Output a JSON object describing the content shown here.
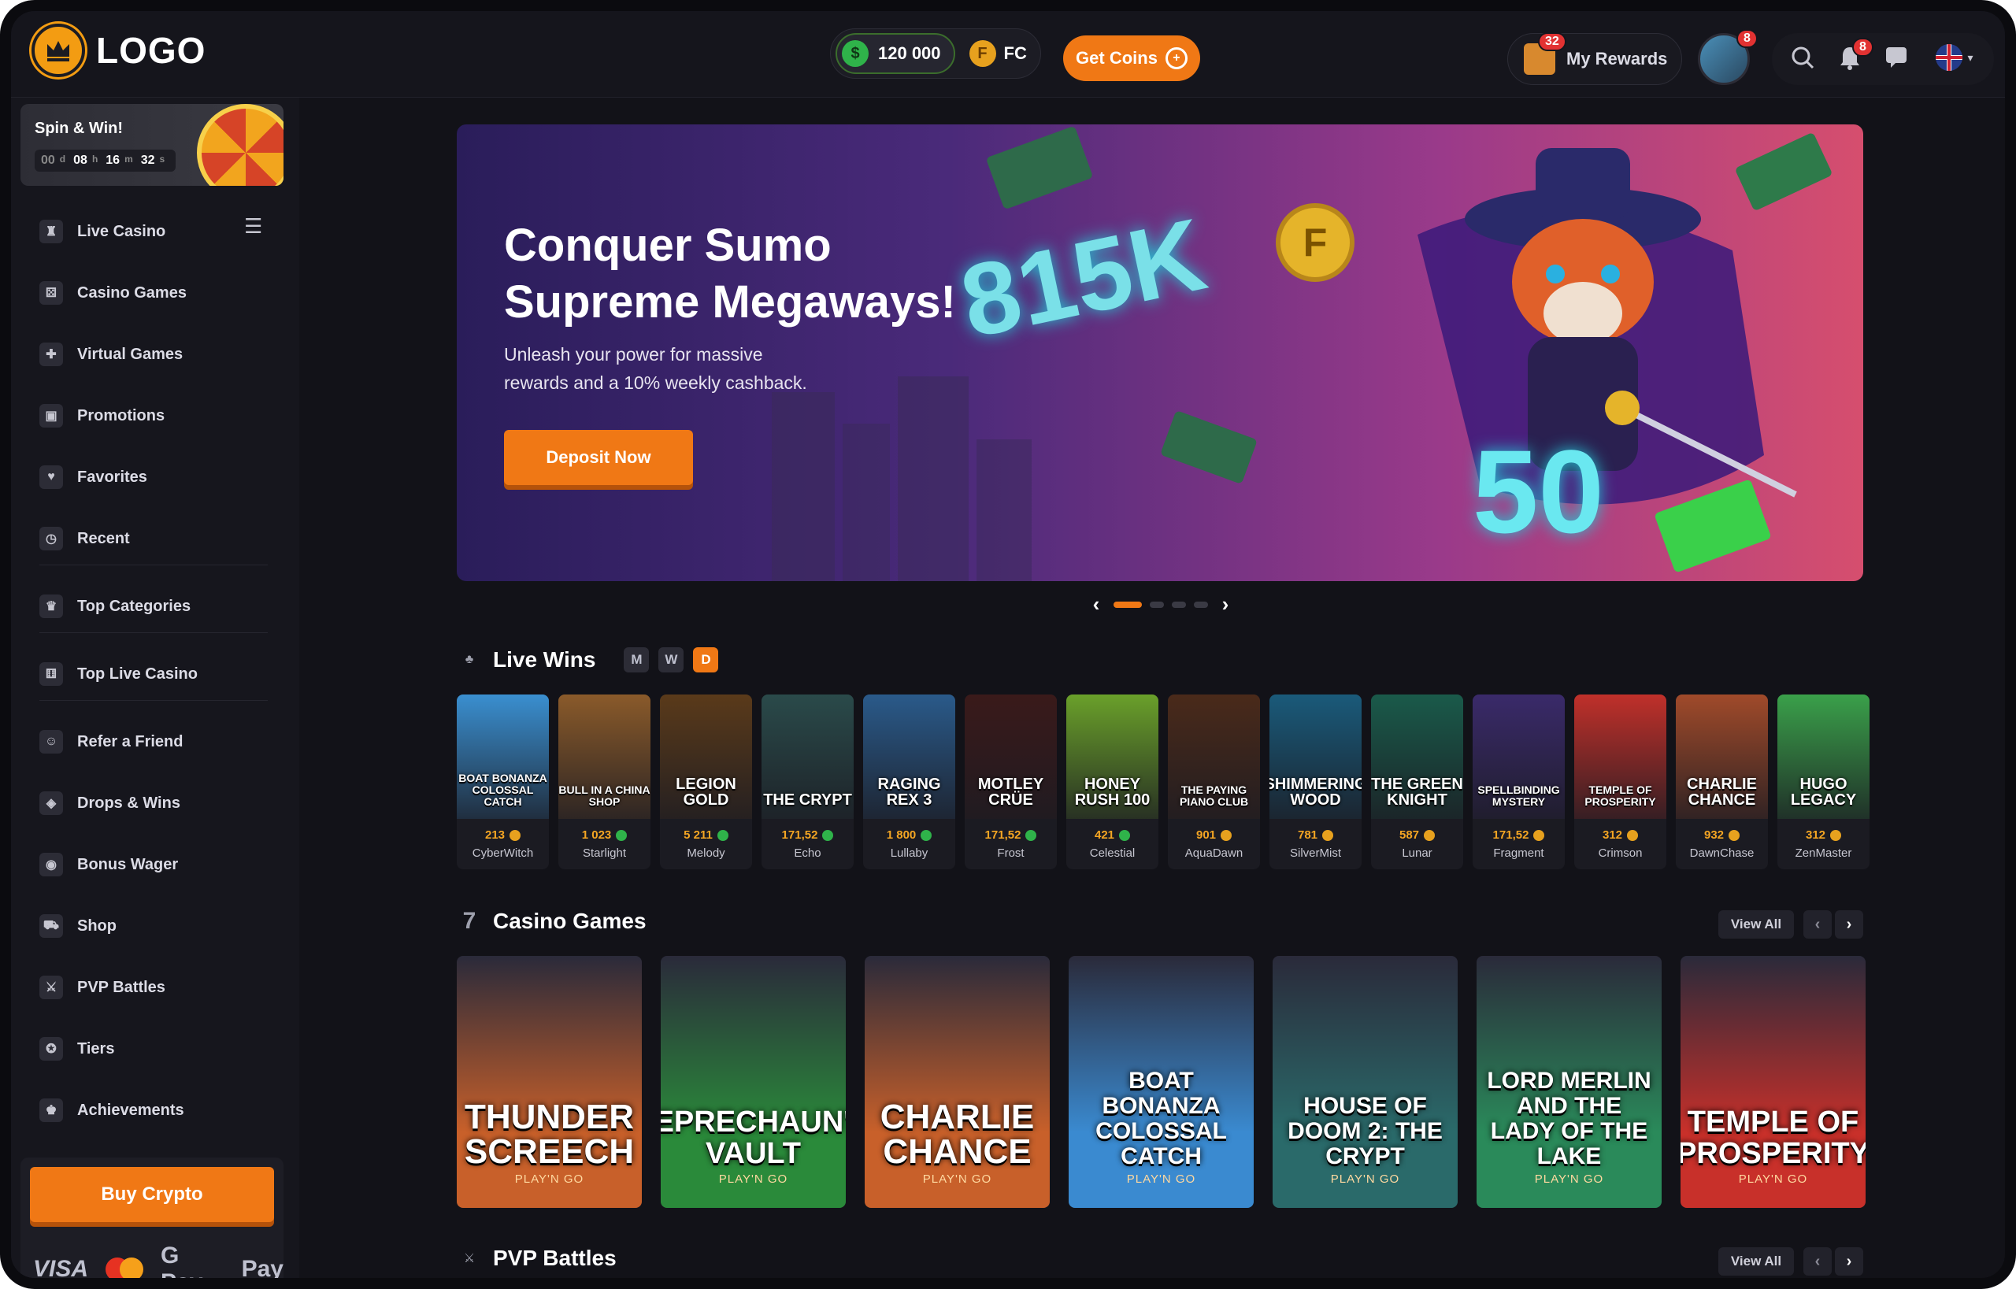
{
  "header": {
    "logo_text": "LOGO",
    "balance": "120 000",
    "fc_label": "FC",
    "get_coins": "Get Coins",
    "my_rewards": "My Rewards",
    "rewards_badge": "32",
    "avatar_badge": "8",
    "notif_badge": "8"
  },
  "spin": {
    "title": "Spin & Win!",
    "days": "00",
    "hours": "08",
    "minutes": "16",
    "seconds": "32",
    "u_d": "d",
    "u_h": "h",
    "u_m": "m",
    "u_s": "s"
  },
  "sidebar": {
    "items": [
      {
        "label": "Live Casino",
        "icon": "live-casino-icon"
      },
      {
        "label": "Casino Games",
        "icon": "dice-icon"
      },
      {
        "label": "Virtual Games",
        "icon": "gamepad-icon"
      },
      {
        "label": "Promotions",
        "icon": "gift-icon"
      },
      {
        "label": "Favorites",
        "icon": "heart-icon"
      },
      {
        "label": "Recent",
        "icon": "clock-icon"
      },
      {
        "label": "Top Categories",
        "icon": "crown-icon"
      },
      {
        "label": "Top Live Casino",
        "icon": "dice-box-icon"
      },
      {
        "label": "Refer a Friend",
        "icon": "refer-icon"
      },
      {
        "label": "Drops & Wins",
        "icon": "drops-icon"
      },
      {
        "label": "Bonus Wager",
        "icon": "bonus-icon"
      },
      {
        "label": "Shop",
        "icon": "cart-icon"
      },
      {
        "label": "PVP Battles",
        "icon": "swords-icon"
      },
      {
        "label": "Tiers",
        "icon": "medal-icon"
      },
      {
        "label": "Achievements",
        "icon": "trophy-icon"
      }
    ],
    "buy_crypto": "Buy Crypto",
    "payments": {
      "visa": "VISA",
      "gpay": "G Pay",
      "applepay": "Pay"
    }
  },
  "hero": {
    "title_line1": "Conquer Sumo",
    "title_line2": "Supreme Megaways!",
    "subtitle_line1": "Unleash your power for massive",
    "subtitle_line2": "rewards and a 10% weekly cashback.",
    "button": "Deposit Now",
    "big_amount": "815K",
    "big_50": "50",
    "coin_letter": "F"
  },
  "live_wins": {
    "title": "Live Wins",
    "tabs": [
      "M",
      "W",
      "D"
    ],
    "active_tab": "D",
    "items": [
      {
        "game": "BOAT BONANZA COLOSSAL CATCH",
        "amount": "213",
        "coin": "gold",
        "user": "CyberWitch",
        "color": "#3a8fd0"
      },
      {
        "game": "BULL IN A CHINA SHOP",
        "amount": "1 023",
        "coin": "green",
        "user": "Starlight",
        "color": "#8a5a2a"
      },
      {
        "game": "LEGION GOLD",
        "amount": "5 211",
        "coin": "green",
        "user": "Melody",
        "color": "#5a3a1a"
      },
      {
        "game": "THE CRYPT",
        "amount": "171,52",
        "coin": "green",
        "user": "Echo",
        "color": "#2a4a4a"
      },
      {
        "game": "RAGING REX 3",
        "amount": "1 800",
        "coin": "green",
        "user": "Lullaby",
        "color": "#2a5a8a"
      },
      {
        "game": "MOTLEY CRÜE",
        "amount": "171,52",
        "coin": "green",
        "user": "Frost",
        "color": "#3a1a1a"
      },
      {
        "game": "HONEY RUSH 100",
        "amount": "421",
        "coin": "green",
        "user": "Celestial",
        "color": "#6aa02a"
      },
      {
        "game": "THE PAYING PIANO CLUB",
        "amount": "901",
        "coin": "gold",
        "user": "AquaDawn",
        "color": "#4a2a1a"
      },
      {
        "game": "SHIMMERING WOOD",
        "amount": "781",
        "coin": "gold",
        "user": "SilverMist",
        "color": "#1a5a7a"
      },
      {
        "game": "THE GREEN KNIGHT",
        "amount": "587",
        "coin": "gold",
        "user": "Lunar",
        "color": "#1a5a4a"
      },
      {
        "game": "SPELLBINDING MYSTERY",
        "amount": "171,52",
        "coin": "gold",
        "user": "Fragment",
        "color": "#3a2a6a"
      },
      {
        "game": "TEMPLE OF PROSPERITY",
        "amount": "312",
        "coin": "gold",
        "user": "Crimson",
        "color": "#c0302a"
      },
      {
        "game": "CHARLIE CHANCE",
        "amount": "932",
        "coin": "gold",
        "user": "DawnChase",
        "color": "#a04a2a"
      },
      {
        "game": "HUGO LEGACY",
        "amount": "312",
        "coin": "gold",
        "user": "ZenMaster",
        "color": "#3aa04a"
      }
    ]
  },
  "casino_games": {
    "title": "Casino Games",
    "view_all": "View All",
    "items": [
      {
        "name": "THUNDER SCREECH",
        "sub": "PLAY'N GO",
        "color": "#c8602a"
      },
      {
        "name": "LEPRECHAUN'S VAULT",
        "sub": "PLAY'N GO",
        "color": "#2a8a3a"
      },
      {
        "name": "CHARLIE CHANCE",
        "sub": "PLAY'N GO",
        "color": "#c8602a"
      },
      {
        "name": "BOAT BONANZA COLOSSAL CATCH",
        "sub": "PLAY'N GO",
        "color": "#3a8ad0"
      },
      {
        "name": "HOUSE OF DOOM 2: THE CRYPT",
        "sub": "PLAY'N GO",
        "color": "#2a6a6a"
      },
      {
        "name": "LORD MERLIN AND THE LADY OF THE LAKE",
        "sub": "PLAY'N GO",
        "color": "#2a8a5a"
      },
      {
        "name": "TEMPLE OF PROSPERITY",
        "sub": "PLAY'N GO",
        "color": "#c8302a"
      }
    ]
  },
  "pvp": {
    "title": "PVP Battles",
    "view_all": "View All"
  }
}
